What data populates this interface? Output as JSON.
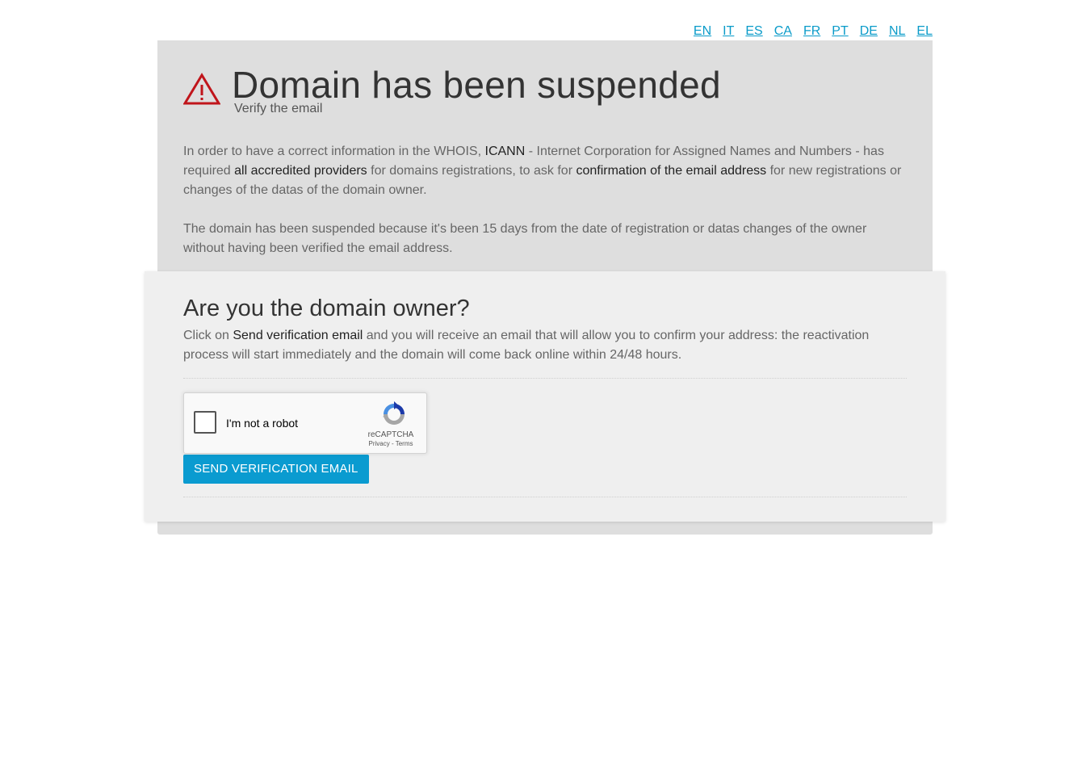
{
  "languages": [
    "EN",
    "IT",
    "ES",
    "CA",
    "FR",
    "PT",
    "DE",
    "NL",
    "EL"
  ],
  "header": {
    "title": "Domain has been suspended",
    "subtitle": "Verify the email",
    "warning_color": "#c0151b"
  },
  "intro": {
    "p1_a": "In order to have a correct information in the WHOIS, ",
    "p1_icann": "ICANN",
    "p1_b": " - Internet Corporation for Assigned Names and Numbers - has required ",
    "p1_providers": "all accredited providers",
    "p1_c": " for domains registrations, to ask for ",
    "p1_confirm": "confirmation of the email address",
    "p1_d": " for new registrations or changes of the datas of the domain owner.",
    "p2": "The domain has been suspended because it's been 15 days from the date of registration or datas changes of the owner without having been verified the email address."
  },
  "owner": {
    "title": "Are you the domain owner?",
    "text_a": "Click on ",
    "text_link": "Send verification email",
    "text_b": " and you will receive an email that will allow you to confirm your address: the reactivation process will start immediately and the domain will come back online within 24/48 hours."
  },
  "captcha": {
    "label": "I'm not a robot",
    "brand": "reCAPTCHA",
    "links": "Privacy - Terms"
  },
  "send_button": {
    "label": "SEND VERIFICATION EMAIL",
    "color": "#0a9bd0"
  }
}
